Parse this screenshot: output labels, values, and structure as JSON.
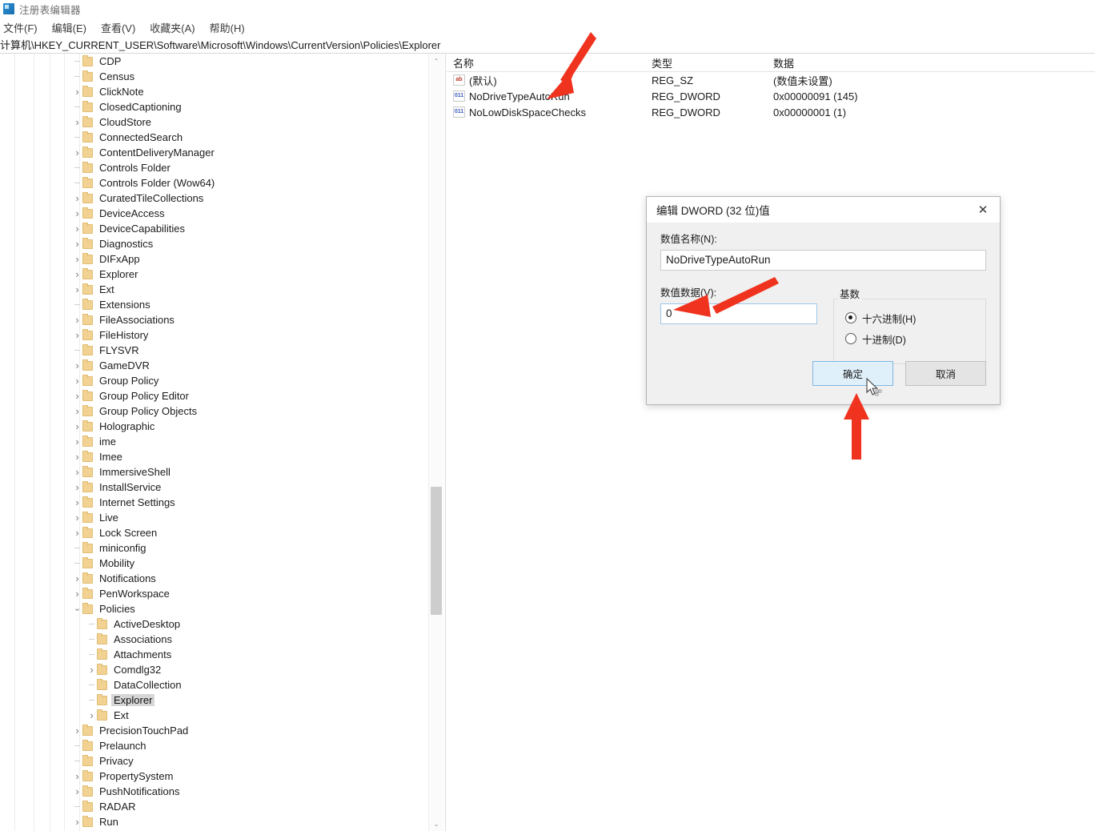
{
  "window": {
    "title": "注册表编辑器",
    "icon": "registry-editor-icon"
  },
  "menubar": {
    "items": [
      {
        "label": "文件(F)"
      },
      {
        "label": "编辑(E)"
      },
      {
        "label": "查看(V)"
      },
      {
        "label": "收藏夹(A)"
      },
      {
        "label": "帮助(H)"
      }
    ]
  },
  "address": {
    "path": "计算机\\HKEY_CURRENT_USER\\Software\\Microsoft\\Windows\\CurrentVersion\\Policies\\Explorer"
  },
  "tree": {
    "nodes": [
      {
        "label": "CDP",
        "indent": 5,
        "marker": "dash",
        "selected": false
      },
      {
        "label": "Census",
        "indent": 5,
        "marker": "dash",
        "selected": false
      },
      {
        "label": "ClickNote",
        "indent": 5,
        "marker": "chevron-right",
        "selected": false
      },
      {
        "label": "ClosedCaptioning",
        "indent": 5,
        "marker": "dash",
        "selected": false
      },
      {
        "label": "CloudStore",
        "indent": 5,
        "marker": "chevron-right",
        "selected": false
      },
      {
        "label": "ConnectedSearch",
        "indent": 5,
        "marker": "dash",
        "selected": false
      },
      {
        "label": "ContentDeliveryManager",
        "indent": 5,
        "marker": "chevron-right",
        "selected": false
      },
      {
        "label": "Controls Folder",
        "indent": 5,
        "marker": "dash",
        "selected": false
      },
      {
        "label": "Controls Folder (Wow64)",
        "indent": 5,
        "marker": "dash",
        "selected": false
      },
      {
        "label": "CuratedTileCollections",
        "indent": 5,
        "marker": "chevron-right",
        "selected": false
      },
      {
        "label": "DeviceAccess",
        "indent": 5,
        "marker": "chevron-right",
        "selected": false
      },
      {
        "label": "DeviceCapabilities",
        "indent": 5,
        "marker": "chevron-right",
        "selected": false
      },
      {
        "label": "Diagnostics",
        "indent": 5,
        "marker": "chevron-right",
        "selected": false
      },
      {
        "label": "DIFxApp",
        "indent": 5,
        "marker": "chevron-right",
        "selected": false
      },
      {
        "label": "Explorer",
        "indent": 5,
        "marker": "chevron-right",
        "selected": false
      },
      {
        "label": "Ext",
        "indent": 5,
        "marker": "chevron-right",
        "selected": false
      },
      {
        "label": "Extensions",
        "indent": 5,
        "marker": "dash",
        "selected": false
      },
      {
        "label": "FileAssociations",
        "indent": 5,
        "marker": "chevron-right",
        "selected": false
      },
      {
        "label": "FileHistory",
        "indent": 5,
        "marker": "chevron-right",
        "selected": false
      },
      {
        "label": "FLYSVR",
        "indent": 5,
        "marker": "dash",
        "selected": false
      },
      {
        "label": "GameDVR",
        "indent": 5,
        "marker": "chevron-right",
        "selected": false
      },
      {
        "label": "Group Policy",
        "indent": 5,
        "marker": "chevron-right",
        "selected": false
      },
      {
        "label": "Group Policy Editor",
        "indent": 5,
        "marker": "chevron-right",
        "selected": false
      },
      {
        "label": "Group Policy Objects",
        "indent": 5,
        "marker": "chevron-right",
        "selected": false
      },
      {
        "label": "Holographic",
        "indent": 5,
        "marker": "chevron-right",
        "selected": false
      },
      {
        "label": "ime",
        "indent": 5,
        "marker": "chevron-right",
        "selected": false
      },
      {
        "label": "Imee",
        "indent": 5,
        "marker": "chevron-right",
        "selected": false
      },
      {
        "label": "ImmersiveShell",
        "indent": 5,
        "marker": "chevron-right",
        "selected": false
      },
      {
        "label": "InstallService",
        "indent": 5,
        "marker": "chevron-right",
        "selected": false
      },
      {
        "label": "Internet Settings",
        "indent": 5,
        "marker": "chevron-right",
        "selected": false
      },
      {
        "label": "Live",
        "indent": 5,
        "marker": "chevron-right",
        "selected": false
      },
      {
        "label": "Lock Screen",
        "indent": 5,
        "marker": "chevron-right",
        "selected": false
      },
      {
        "label": "miniconfig",
        "indent": 5,
        "marker": "dash",
        "selected": false
      },
      {
        "label": "Mobility",
        "indent": 5,
        "marker": "dash",
        "selected": false
      },
      {
        "label": "Notifications",
        "indent": 5,
        "marker": "chevron-right",
        "selected": false
      },
      {
        "label": "PenWorkspace",
        "indent": 5,
        "marker": "chevron-right",
        "selected": false
      },
      {
        "label": "Policies",
        "indent": 5,
        "marker": "chevron-down",
        "selected": false
      },
      {
        "label": "ActiveDesktop",
        "indent": 6,
        "marker": "dash",
        "selected": false
      },
      {
        "label": "Associations",
        "indent": 6,
        "marker": "dash",
        "selected": false
      },
      {
        "label": "Attachments",
        "indent": 6,
        "marker": "dash",
        "selected": false
      },
      {
        "label": "Comdlg32",
        "indent": 6,
        "marker": "chevron-right",
        "selected": false
      },
      {
        "label": "DataCollection",
        "indent": 6,
        "marker": "dash",
        "selected": false
      },
      {
        "label": "Explorer",
        "indent": 6,
        "marker": "dash",
        "selected": true
      },
      {
        "label": "Ext",
        "indent": 6,
        "marker": "chevron-right",
        "selected": false
      },
      {
        "label": "PrecisionTouchPad",
        "indent": 5,
        "marker": "chevron-right",
        "selected": false
      },
      {
        "label": "Prelaunch",
        "indent": 5,
        "marker": "dash",
        "selected": false
      },
      {
        "label": "Privacy",
        "indent": 5,
        "marker": "dash",
        "selected": false
      },
      {
        "label": "PropertySystem",
        "indent": 5,
        "marker": "chevron-right",
        "selected": false
      },
      {
        "label": "PushNotifications",
        "indent": 5,
        "marker": "chevron-right",
        "selected": false
      },
      {
        "label": "RADAR",
        "indent": 5,
        "marker": "dash",
        "selected": false
      },
      {
        "label": "Run",
        "indent": 5,
        "marker": "chevron-right",
        "selected": false
      }
    ]
  },
  "values": {
    "columns": {
      "name": "名称",
      "type": "类型",
      "data": "数据"
    },
    "rows": [
      {
        "icon": "string-value-icon",
        "icon_text": "ab",
        "name": "(默认)",
        "type": "REG_SZ",
        "data": "(数值未设置)"
      },
      {
        "icon": "dword-value-icon",
        "icon_text": "011",
        "name": "NoDriveTypeAutoRun",
        "type": "REG_DWORD",
        "data": "0x00000091 (145)"
      },
      {
        "icon": "dword-value-icon",
        "icon_text": "011",
        "name": "NoLowDiskSpaceChecks",
        "type": "REG_DWORD",
        "data": "0x00000001 (1)"
      }
    ]
  },
  "dialog": {
    "title": "编辑 DWORD (32 位)值",
    "close_label": "✕",
    "name_label": "数值名称(N):",
    "name_value": "NoDriveTypeAutoRun",
    "data_label": "数值数据(V):",
    "data_value": "0",
    "base_group_label": "基数",
    "radio_hex": "十六进制(H)",
    "radio_dec": "十进制(D)",
    "radio_selected": "十六进制(H)",
    "ok_label": "确定",
    "cancel_label": "取消"
  },
  "scrollbar": {
    "up_glyph": "⌃",
    "down_glyph": "⌄"
  },
  "annotations": {
    "arrow_color": "#f0331f",
    "arrows": [
      {
        "name": "arrow-to-nodrivetypeautorun"
      },
      {
        "name": "arrow-to-value-data-field"
      },
      {
        "name": "arrow-to-ok-button"
      }
    ]
  }
}
